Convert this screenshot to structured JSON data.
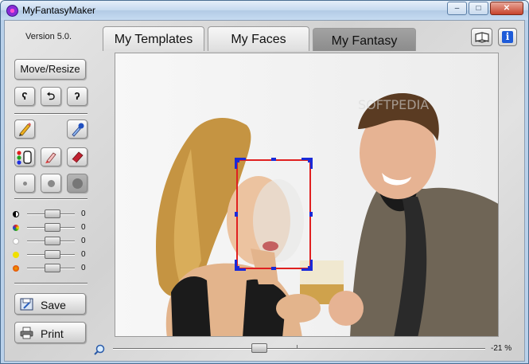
{
  "window": {
    "title": "MyFantasyMaker",
    "controls": {
      "minimize": "–",
      "maximize": "□",
      "close": "✕"
    }
  },
  "header": {
    "version": "Version 5.0.",
    "tabs": [
      {
        "label": "My Templates",
        "active": false
      },
      {
        "label": "My Faces",
        "active": false
      },
      {
        "label": "My Fantasy",
        "active": true
      }
    ],
    "help_icon": "book-icon",
    "info_icon": "info-icon",
    "info_glyph": "i"
  },
  "sidebar": {
    "move_resize_label": "Move/Resize",
    "rotate_buttons": [
      {
        "icon": "rotate-left-icon",
        "glyph": "ʕ"
      },
      {
        "icon": "flip-icon",
        "glyph": "⮌"
      },
      {
        "icon": "rotate-right-icon",
        "glyph": "ʔ"
      }
    ],
    "tool_icons": [
      "pencil-icon",
      "eyedropper-icon",
      "color-picker-icon",
      "brush-icon",
      "eraser-icon"
    ],
    "brush_sizes": [
      "small",
      "medium",
      "large"
    ],
    "sliders": [
      {
        "name": "brightness",
        "value": "0",
        "color": "#000000"
      },
      {
        "name": "hue",
        "value": "0",
        "color": "#3a8a3a"
      },
      {
        "name": "white",
        "value": "0",
        "color": "#ffffff"
      },
      {
        "name": "yellow",
        "value": "0",
        "color": "#f0e000"
      },
      {
        "name": "red",
        "value": "0",
        "color": "#e05020"
      }
    ],
    "save_label": "Save",
    "print_label": "Print"
  },
  "zoom": {
    "icon": "magnifier-icon",
    "value_label": "-21 %"
  },
  "colors": {
    "selection_frame": "#e02020",
    "selection_handles": "#1a2ad8",
    "active_tab": "#959595"
  }
}
